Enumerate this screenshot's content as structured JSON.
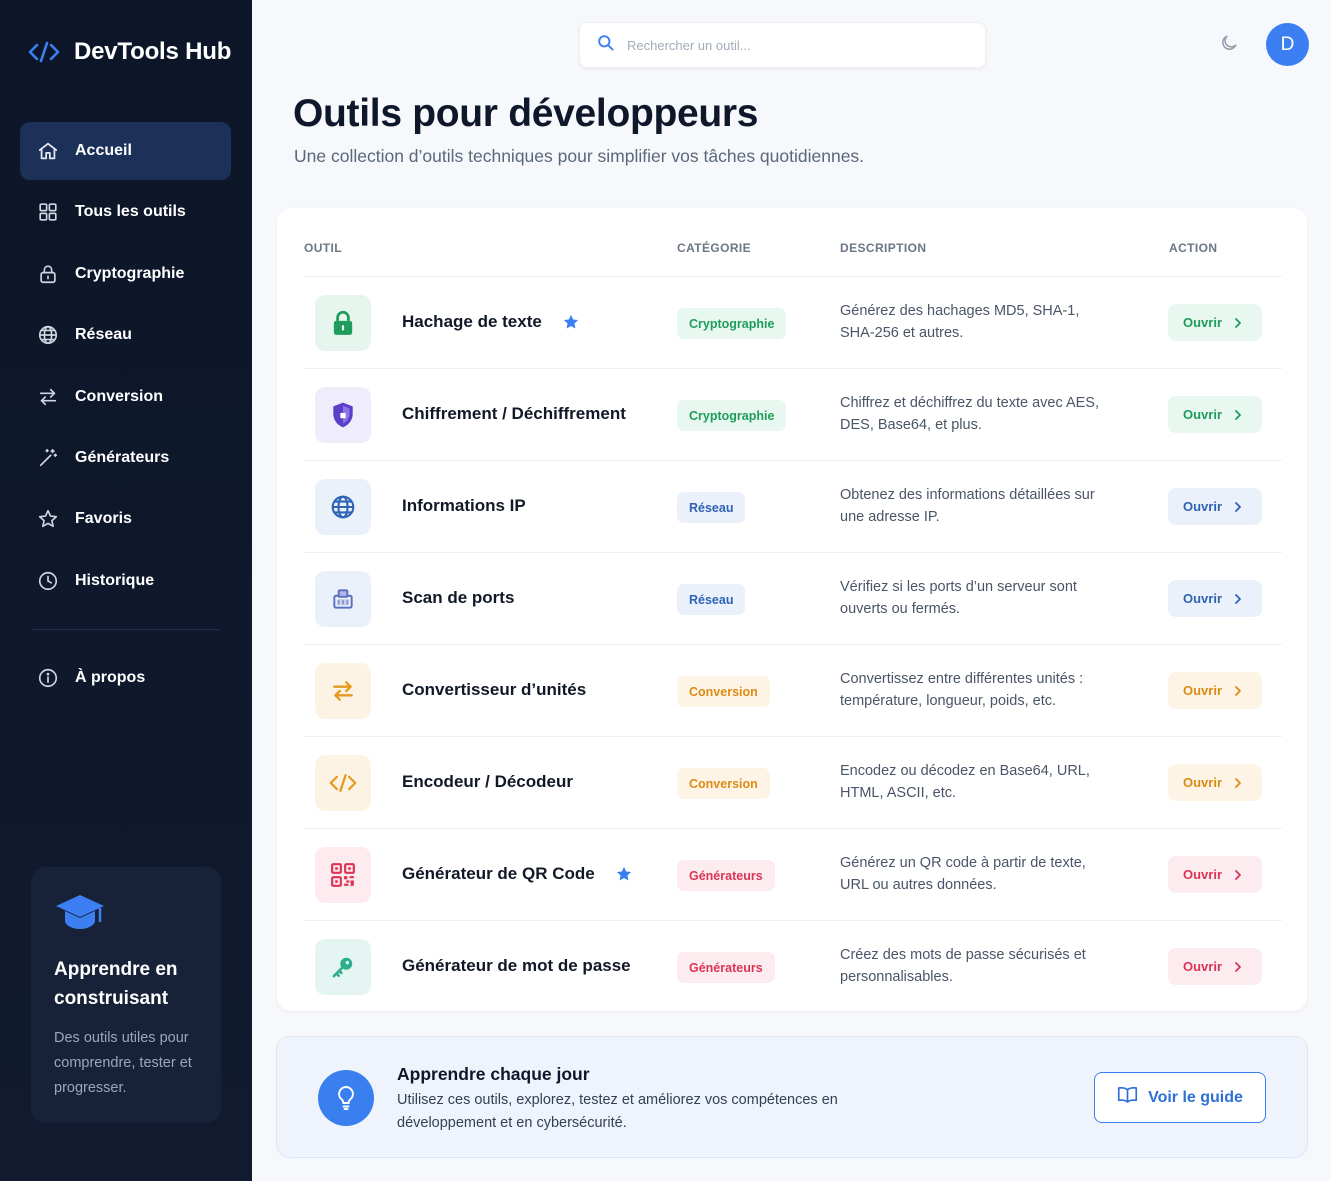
{
  "app": {
    "name": "DevTools Hub"
  },
  "sidebar": {
    "items": [
      {
        "label": "Accueil",
        "icon": "home-icon",
        "active": true
      },
      {
        "label": "Tous les outils",
        "icon": "grid-icon"
      },
      {
        "label": "Cryptographie",
        "icon": "lock-icon"
      },
      {
        "label": "Réseau",
        "icon": "globe-icon"
      },
      {
        "label": "Conversion",
        "icon": "arrows-icon"
      },
      {
        "label": "Générateurs",
        "icon": "magic-wand-icon"
      },
      {
        "label": "Favoris",
        "icon": "star-icon"
      },
      {
        "label": "Historique",
        "icon": "clock-icon"
      }
    ],
    "about": {
      "label": "À propos",
      "icon": "info-icon"
    },
    "card": {
      "title": "Apprendre en construisant",
      "text": "Des outils utiles pour comprendre, tester et progresser."
    }
  },
  "header": {
    "search_placeholder": "Rechercher un outil...",
    "avatar_initial": "D"
  },
  "main": {
    "title": "Outils pour développeurs",
    "subtitle": "Une collection d’outils techniques pour simplifier vos tâches quotidiennes."
  },
  "table": {
    "columns": [
      "OUTIL",
      "CATÉGORIE",
      "DESCRIPTION",
      "ACTION"
    ],
    "rows": [
      {
        "name": "Hachage de texte",
        "favorite": true,
        "category": "Cryptographie",
        "description": "Générez des hachages MD5, SHA-1, SHA-256 et autres.",
        "action": "Ouvrir",
        "icon": "lock-icon",
        "palette": "green"
      },
      {
        "name": "Chiffrement / Déchiffrement",
        "favorite": false,
        "category": "Cryptographie",
        "description": "Chiffrez et déchiffrez du texte avec AES, DES, Base64, et plus.",
        "action": "Ouvrir",
        "icon": "shield-icon",
        "palette": "purple"
      },
      {
        "name": "Informations IP",
        "favorite": false,
        "category": "Réseau",
        "description": "Obtenez des informations détaillées sur une adresse IP.",
        "action": "Ouvrir",
        "icon": "globe-icon",
        "palette": "blue"
      },
      {
        "name": "Scan de ports",
        "favorite": false,
        "category": "Réseau",
        "description": "Vérifiez si les ports d’un serveur sont ouverts ou fermés.",
        "action": "Ouvrir",
        "icon": "network-icon",
        "palette": "blue"
      },
      {
        "name": "Convertisseur d’unités",
        "favorite": false,
        "category": "Conversion",
        "description": "Convertissez entre différentes unités : température, longueur, poids, etc.",
        "action": "Ouvrir",
        "icon": "arrows-icon",
        "palette": "orange"
      },
      {
        "name": "Encodeur / Décodeur",
        "favorite": false,
        "category": "Conversion",
        "description": "Encodez ou décodez en Base64, URL, HTML, ASCII, etc.",
        "action": "Ouvrir",
        "icon": "code-icon",
        "palette": "orange"
      },
      {
        "name": "Générateur de QR Code",
        "favorite": true,
        "category": "Générateurs",
        "description": "Générez un QR code à partir de texte, URL ou autres données.",
        "action": "Ouvrir",
        "icon": "qr-code-icon",
        "palette": "pink"
      },
      {
        "name": "Générateur de mot de passe",
        "favorite": false,
        "category": "Générateurs",
        "description": "Créez des mots de passe sécurisés et personnalisables.",
        "action": "Ouvrir",
        "icon": "key-icon",
        "palette": "teal"
      }
    ]
  },
  "banner": {
    "title": "Apprendre chaque jour",
    "text": "Utilisez ces outils, explorez, testez et améliorez vos compétences en développement et en cybersécurité.",
    "button_label": "Voir le guide"
  },
  "colors": {
    "sidebar_bg": "#0d1629",
    "accent": "#3b7ff2",
    "star": "#3b7ff2"
  }
}
